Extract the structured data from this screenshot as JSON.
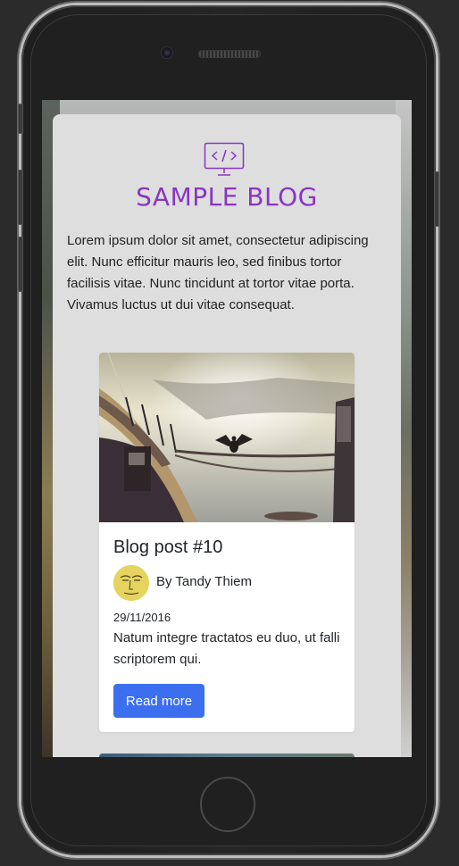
{
  "colors": {
    "accent_purple": "#8a35c4",
    "button_blue": "#3b6fef",
    "panel_gray": "#dedede"
  },
  "blog": {
    "logo_icon": "code-monitor-icon",
    "title": "SAMPLE BLOG",
    "intro": "Lorem ipsum dolor sit amet, consectetur adipiscing elit. Nunc efficitur mauris leo, sed finibus tortor facilisis vitae. Nunc tincidunt at tortor vitae porta. Vivamus luctus ut dui vitae consequat."
  },
  "posts": [
    {
      "title": "Blog post #10",
      "author": "By Tandy Thiem",
      "date": "29/11/2016",
      "excerpt": "Natum integre tractatos eu duo, ut falli scriptorem qui.",
      "button_label": "Read more"
    }
  ]
}
